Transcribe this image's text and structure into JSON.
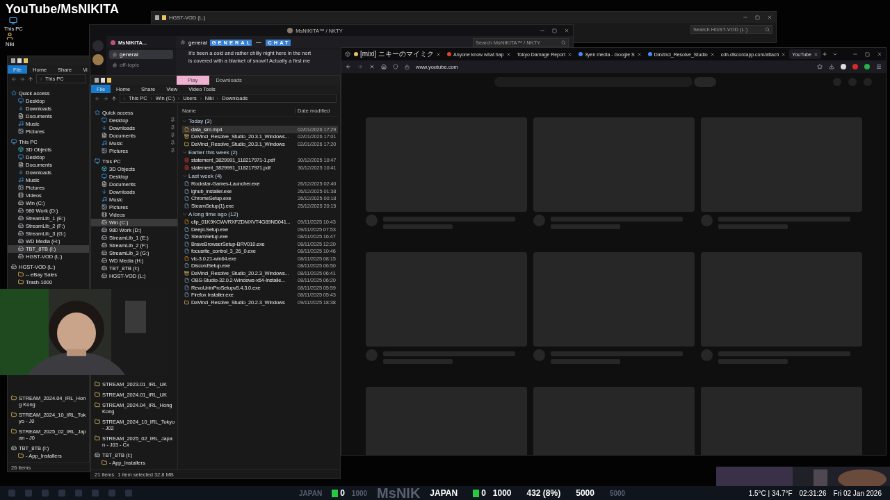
{
  "overlay_title": "YouTube/MsNIKITA",
  "desktop_icons": [
    {
      "label": "This PC",
      "kind": "pc"
    },
    {
      "label": "Niki",
      "kind": "user"
    }
  ],
  "back_window": {
    "title": "HGST-VOD (L:)",
    "search_placeholder": "Search HGST-VOD (L:)"
  },
  "discord": {
    "title": "MsNIKITA™ / NKTY",
    "search_placeholder": "Search MsNIKITA™ / NKTY",
    "server": "MsNIKITA...",
    "channels": [
      {
        "name": "general",
        "selected": true
      },
      {
        "name": "off-topic",
        "selected": false
      }
    ],
    "header_channel": "general",
    "topic_words": [
      "GENERAL",
      "CHAT"
    ],
    "messages": [
      "It's been a cold and rather chilly night here in the nort",
      "is covered with a blanket of snow!! Actually a first me"
    ]
  },
  "left_explorer": {
    "ribbon": [
      {
        "label": "File",
        "selected": true
      },
      {
        "label": "Home",
        "selected": false
      },
      {
        "label": "Share",
        "selected": false
      },
      {
        "label": "Vi",
        "selected": false
      }
    ],
    "path": [
      "This PC"
    ],
    "tree": [
      {
        "label": "Quick access",
        "kind": "star",
        "selected": false,
        "children": [
          {
            "label": "Desktop",
            "kind": "desktop",
            "selected": false
          },
          {
            "label": "Downloads",
            "kind": "download",
            "selected": false
          },
          {
            "label": "Documents",
            "kind": "document",
            "selected": false
          },
          {
            "label": "Music",
            "kind": "music",
            "selected": false
          },
          {
            "label": "Pictures",
            "kind": "pictures",
            "selected": false
          }
        ]
      },
      {
        "label": "This PC",
        "kind": "pc",
        "selected": false,
        "children": [
          {
            "label": "3D Objects",
            "kind": "cube",
            "selected": false
          },
          {
            "label": "Desktop",
            "kind": "desktop",
            "selected": false
          },
          {
            "label": "Documents",
            "kind": "document",
            "selected": false
          },
          {
            "label": "Downloads",
            "kind": "download",
            "selected": false
          },
          {
            "label": "Music",
            "kind": "music",
            "selected": false
          },
          {
            "label": "Pictures",
            "kind": "pictures",
            "selected": false
          },
          {
            "label": "Videos",
            "kind": "videos",
            "selected": false
          },
          {
            "label": "Win (C:)",
            "kind": "drive",
            "selected": false
          },
          {
            "label": "980 Work (D:)",
            "kind": "drive",
            "selected": false
          },
          {
            "label": "StreamLib_1 (E:)",
            "kind": "drive",
            "selected": false
          },
          {
            "label": "StreamLib_2 (F:)",
            "kind": "drive",
            "selected": false
          },
          {
            "label": "StreamLib_3 (G:)",
            "kind": "drive",
            "selected": false
          },
          {
            "label": "WD Media (H:)",
            "kind": "drive",
            "selected": false
          },
          {
            "label": "TBT_8TB (I:)",
            "kind": "drive",
            "selected": true
          },
          {
            "label": "HGST-VOD (L:)",
            "kind": "drive",
            "selected": false
          }
        ]
      },
      {
        "label": "HGST-VOD (L:)",
        "kind": "drive",
        "selected": false,
        "children": [
          {
            "label": "-- eBay Sales",
            "kind": "folder",
            "selected": false
          },
          {
            "label": "Trash-1000",
            "kind": "folder",
            "selected": false
          }
        ]
      }
    ],
    "bottom_tree": [
      {
        "label": "STREAM_2024.04_IRL_Hong Kong",
        "kind": "folder",
        "selected": false
      },
      {
        "label": "STREAM_2024_10_IRL_Tokyo - J0",
        "kind": "folder",
        "selected": false
      },
      {
        "label": "STREAM_2025_02_IRL_Japan - J0",
        "kind": "folder",
        "selected": false
      },
      {
        "label": "TBT_8TB (I:)",
        "kind": "drive",
        "selected": false,
        "children": [
          {
            "label": "- App_Installers",
            "kind": "folder",
            "selected": false
          }
        ]
      }
    ],
    "status": "26 items"
  },
  "main_explorer": {
    "context_tab": "Play",
    "title": "Downloads",
    "ribbon": [
      {
        "label": "File",
        "selected": true
      },
      {
        "label": "Home",
        "selected": false
      },
      {
        "label": "Share",
        "selected": false
      },
      {
        "label": "View",
        "selected": false
      },
      {
        "label": "Video Tools",
        "selected": false
      }
    ],
    "path": [
      "This PC",
      "Win (C:)",
      "Users",
      "Niki",
      "Downloads"
    ],
    "tree": [
      {
        "label": "Quick access",
        "kind": "star",
        "selected": false,
        "children": [
          {
            "label": "Desktop",
            "kind": "desktop",
            "selected": false,
            "pinned": true
          },
          {
            "label": "Downloads",
            "kind": "download",
            "selected": false,
            "pinned": true
          },
          {
            "label": "Documents",
            "kind": "document",
            "selected": false,
            "pinned": true
          },
          {
            "label": "Music",
            "kind": "music",
            "selected": false,
            "pinned": true
          },
          {
            "label": "Pictures",
            "kind": "pictures",
            "selected": false,
            "pinned": true
          }
        ]
      },
      {
        "label": "This PC",
        "kind": "pc",
        "selected": false,
        "children": [
          {
            "label": "3D Objects",
            "kind": "cube",
            "selected": false
          },
          {
            "label": "Desktop",
            "kind": "desktop",
            "selected": false
          },
          {
            "label": "Documents",
            "kind": "document",
            "selected": false
          },
          {
            "label": "Downloads",
            "kind": "download",
            "selected": false
          },
          {
            "label": "Music",
            "kind": "music",
            "selected": false
          },
          {
            "label": "Pictures",
            "kind": "pictures",
            "selected": false
          },
          {
            "label": "Videos",
            "kind": "videos",
            "selected": false
          },
          {
            "label": "Win (C:)",
            "kind": "drive",
            "selected": true
          },
          {
            "label": "980 Work (D:)",
            "kind": "drive",
            "selected": false
          },
          {
            "label": "StreamLib_1 (E:)",
            "kind": "drive",
            "selected": false
          },
          {
            "label": "StreamLib_2 (F:)",
            "kind": "drive",
            "selected": false
          },
          {
            "label": "StreamLib_3 (G:)",
            "kind": "drive",
            "selected": false
          },
          {
            "label": "WD Media (H:)",
            "kind": "drive",
            "selected": false
          },
          {
            "label": "TBT_8TB (I:)",
            "kind": "drive",
            "selected": false
          },
          {
            "label": "HGST-VOD (L:)",
            "kind": "drive",
            "selected": false
          }
        ]
      }
    ],
    "bottom_tree": [
      {
        "label": "STREAM_2023.01_IRL_UK",
        "kind": "folder",
        "selected": false
      },
      {
        "label": "STREAM_2024.01_IRL_UK",
        "kind": "folder",
        "selected": false
      },
      {
        "label": "STREAM_2024.04_IRL_Hong Kong",
        "kind": "folder",
        "selected": false
      },
      {
        "label": "STREAM_2024_10_IRL_Tokyo - J02",
        "kind": "folder",
        "selected": false
      },
      {
        "label": "STREAM_2025_02_IRL_Japan - J03 - Cx",
        "kind": "folder",
        "selected": false
      },
      {
        "label": "TBT_8TB (I:)",
        "kind": "drive",
        "selected": false,
        "children": [
          {
            "label": "- App_Installers",
            "kind": "folder",
            "selected": false
          }
        ]
      }
    ],
    "columns": [
      "Name",
      "Date modified"
    ],
    "groups": [
      {
        "title": "Today (3)",
        "files": [
          {
            "name": "data_sim.mp4",
            "date": "02/01/2026 17:29",
            "kind": "video",
            "selected": true
          },
          {
            "name": "DaVinci_Resolve_Studio_20.3.1_Windows...",
            "date": "02/01/2026 17:01",
            "kind": "zip",
            "selected": false
          },
          {
            "name": "DaVinci_Resolve_Studio_20.3.1_Windows",
            "date": "02/01/2026 17:20",
            "kind": "folder",
            "selected": false
          }
        ]
      },
      {
        "title": "Earlier this week (2)",
        "files": [
          {
            "name": "statement_3829991_118217971-1.pdf",
            "date": "30/12/2025 10:47",
            "kind": "pdf",
            "selected": false
          },
          {
            "name": "statement_3829991_118217971.pdf",
            "date": "30/12/2025 10:41",
            "kind": "pdf",
            "selected": false
          }
        ]
      },
      {
        "title": "Last week (4)",
        "files": [
          {
            "name": "Rockstar-Games-Launcher.exe",
            "date": "26/12/2025 02:40",
            "kind": "exe",
            "selected": false
          },
          {
            "name": "lghub_installer.exe",
            "date": "26/12/2025 01:38",
            "kind": "exe",
            "selected": false
          },
          {
            "name": "ChromeSetup.exe",
            "date": "26/12/2025 00:18",
            "kind": "exe",
            "selected": false
          },
          {
            "name": "SteamSetup(1).exe",
            "date": "25/12/2025 20:15",
            "kind": "exe",
            "selected": false
          }
        ]
      },
      {
        "title": "A long time ago (12)",
        "files": [
          {
            "name": "clip_01K9KCWVRXFZDMXVT4G89ND041...",
            "date": "09/11/2025 10:43",
            "kind": "video",
            "selected": false
          },
          {
            "name": "DeepLSetup.exe",
            "date": "09/11/2025 07:53",
            "kind": "exe",
            "selected": false
          },
          {
            "name": "SteamSetup.exe",
            "date": "08/11/2025 16:47",
            "kind": "exe",
            "selected": false
          },
          {
            "name": "BraveBrowserSetup-BRV010.exe",
            "date": "08/11/2025 12:20",
            "kind": "exe",
            "selected": false
          },
          {
            "name": "focusrite_control_3_26_0.exe",
            "date": "08/11/2025 10:46",
            "kind": "exe",
            "selected": false
          },
          {
            "name": "vlc-3.0.21-win64.exe",
            "date": "08/11/2025 08:15",
            "kind": "video",
            "selected": false
          },
          {
            "name": "DiscordSetup.exe",
            "date": "08/11/2025 06:50",
            "kind": "exe",
            "selected": false
          },
          {
            "name": "DaVinci_Resolve_Studio_20.2.3_Windows...",
            "date": "08/11/2025 06:41",
            "kind": "zip",
            "selected": false
          },
          {
            "name": "OBS-Studio-32.0.2-Windows-x64-Installe...",
            "date": "08/11/2025 06:20",
            "kind": "exe",
            "selected": false
          },
          {
            "name": "RevoUninProSetupv5.4.3.0.exe",
            "date": "08/11/2025 05:59",
            "kind": "exe",
            "selected": false
          },
          {
            "name": "Firefox Installer.exe",
            "date": "08/11/2025 05:43",
            "kind": "exe",
            "selected": false
          },
          {
            "name": "DaVinci_Resolve_Studio_20.2.3_Windows",
            "date": "09/11/2025 18:38",
            "kind": "folder",
            "selected": false
          }
        ]
      }
    ],
    "status": [
      "21 items",
      "1 item selected  32.8 MB"
    ]
  },
  "browser": {
    "tabs": [
      {
        "title": "[mixi] ニキーのマイミク",
        "selected": false,
        "color": "#e0c060"
      },
      {
        "title": "Anyone know what hap",
        "selected": false,
        "color": "#e0452a"
      },
      {
        "title": "Tokyo Damage Report",
        "selected": false
      },
      {
        "title": "3yen media - Google S",
        "selected": false,
        "color": "#4a8af4"
      },
      {
        "title": "DaVinci_Resolve_Studio",
        "selected": false,
        "color": "#4a8af4"
      },
      {
        "title": "cdn.discordapp.com/attach",
        "selected": false
      },
      {
        "title": "YouTube",
        "selected": true
      }
    ],
    "url": "www.youtube.com"
  },
  "stream_bar": [
    {
      "kind": "dim",
      "text": "JAPAN"
    },
    {
      "kind": "kick",
      "text": "0"
    },
    {
      "kind": "dim",
      "text": "1000"
    },
    {
      "kind": "brand",
      "text": "MsNIK"
    },
    {
      "kind": "bright",
      "text": "JAPAN"
    },
    {
      "kind": "kick",
      "text": "0"
    },
    {
      "kind": "bright",
      "text": "1000"
    },
    {
      "kind": "bright",
      "text": "432 (8%)"
    },
    {
      "kind": "bright",
      "text": "5000"
    },
    {
      "kind": "dim",
      "text": "5000"
    }
  ],
  "stats": [
    "1.5°C | 34.7°F",
    "02:31:26",
    "Fri 02 Jan 2026"
  ]
}
